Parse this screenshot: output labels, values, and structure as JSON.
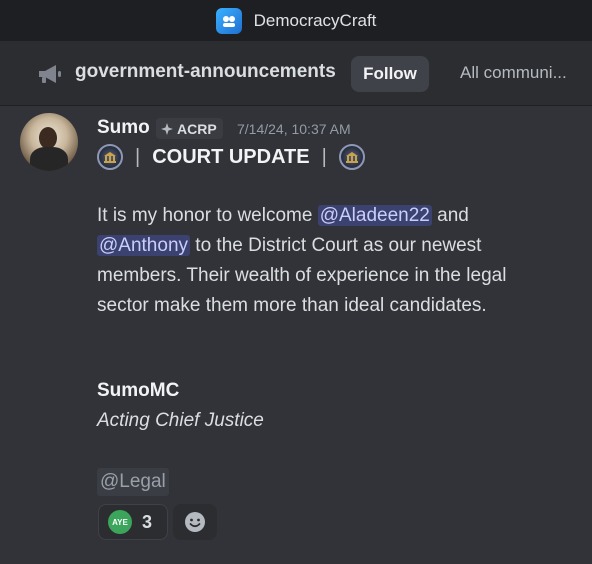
{
  "window": {
    "title": "DemocracyCraft"
  },
  "channel": {
    "name": "government-announcements",
    "follow_label": "Follow",
    "all_communities_label": "All communi..."
  },
  "message": {
    "author": "Sumo",
    "role_tag": "ACRP",
    "timestamp": "7/14/24, 10:37 AM",
    "header_sep_left": "|",
    "header_title": "COURT UPDATE",
    "header_sep_right": "|",
    "body": {
      "part1": "It is my honor to welcome ",
      "mention1": "@Aladeen22",
      "part2": " and ",
      "mention2": "@Anthony",
      "part3": " to the District Court as our newest members. Their wealth of experience in the legal sector make them more than ideal candidates."
    },
    "signature_name": "SumoMC",
    "signature_title": "Acting Chief Justice",
    "role_mention": "@Legal",
    "reaction": {
      "emoji_label": "AYE",
      "count": "3"
    }
  },
  "colors": {
    "background": "#313338",
    "mention_bg": "#3c4270",
    "aye_green": "#3ba55c"
  },
  "icons": {
    "app": "democracycraft-app-icon",
    "channel": "megaphone-icon",
    "seal": "court-seal-icon",
    "add_reaction": "smiley-icon"
  }
}
